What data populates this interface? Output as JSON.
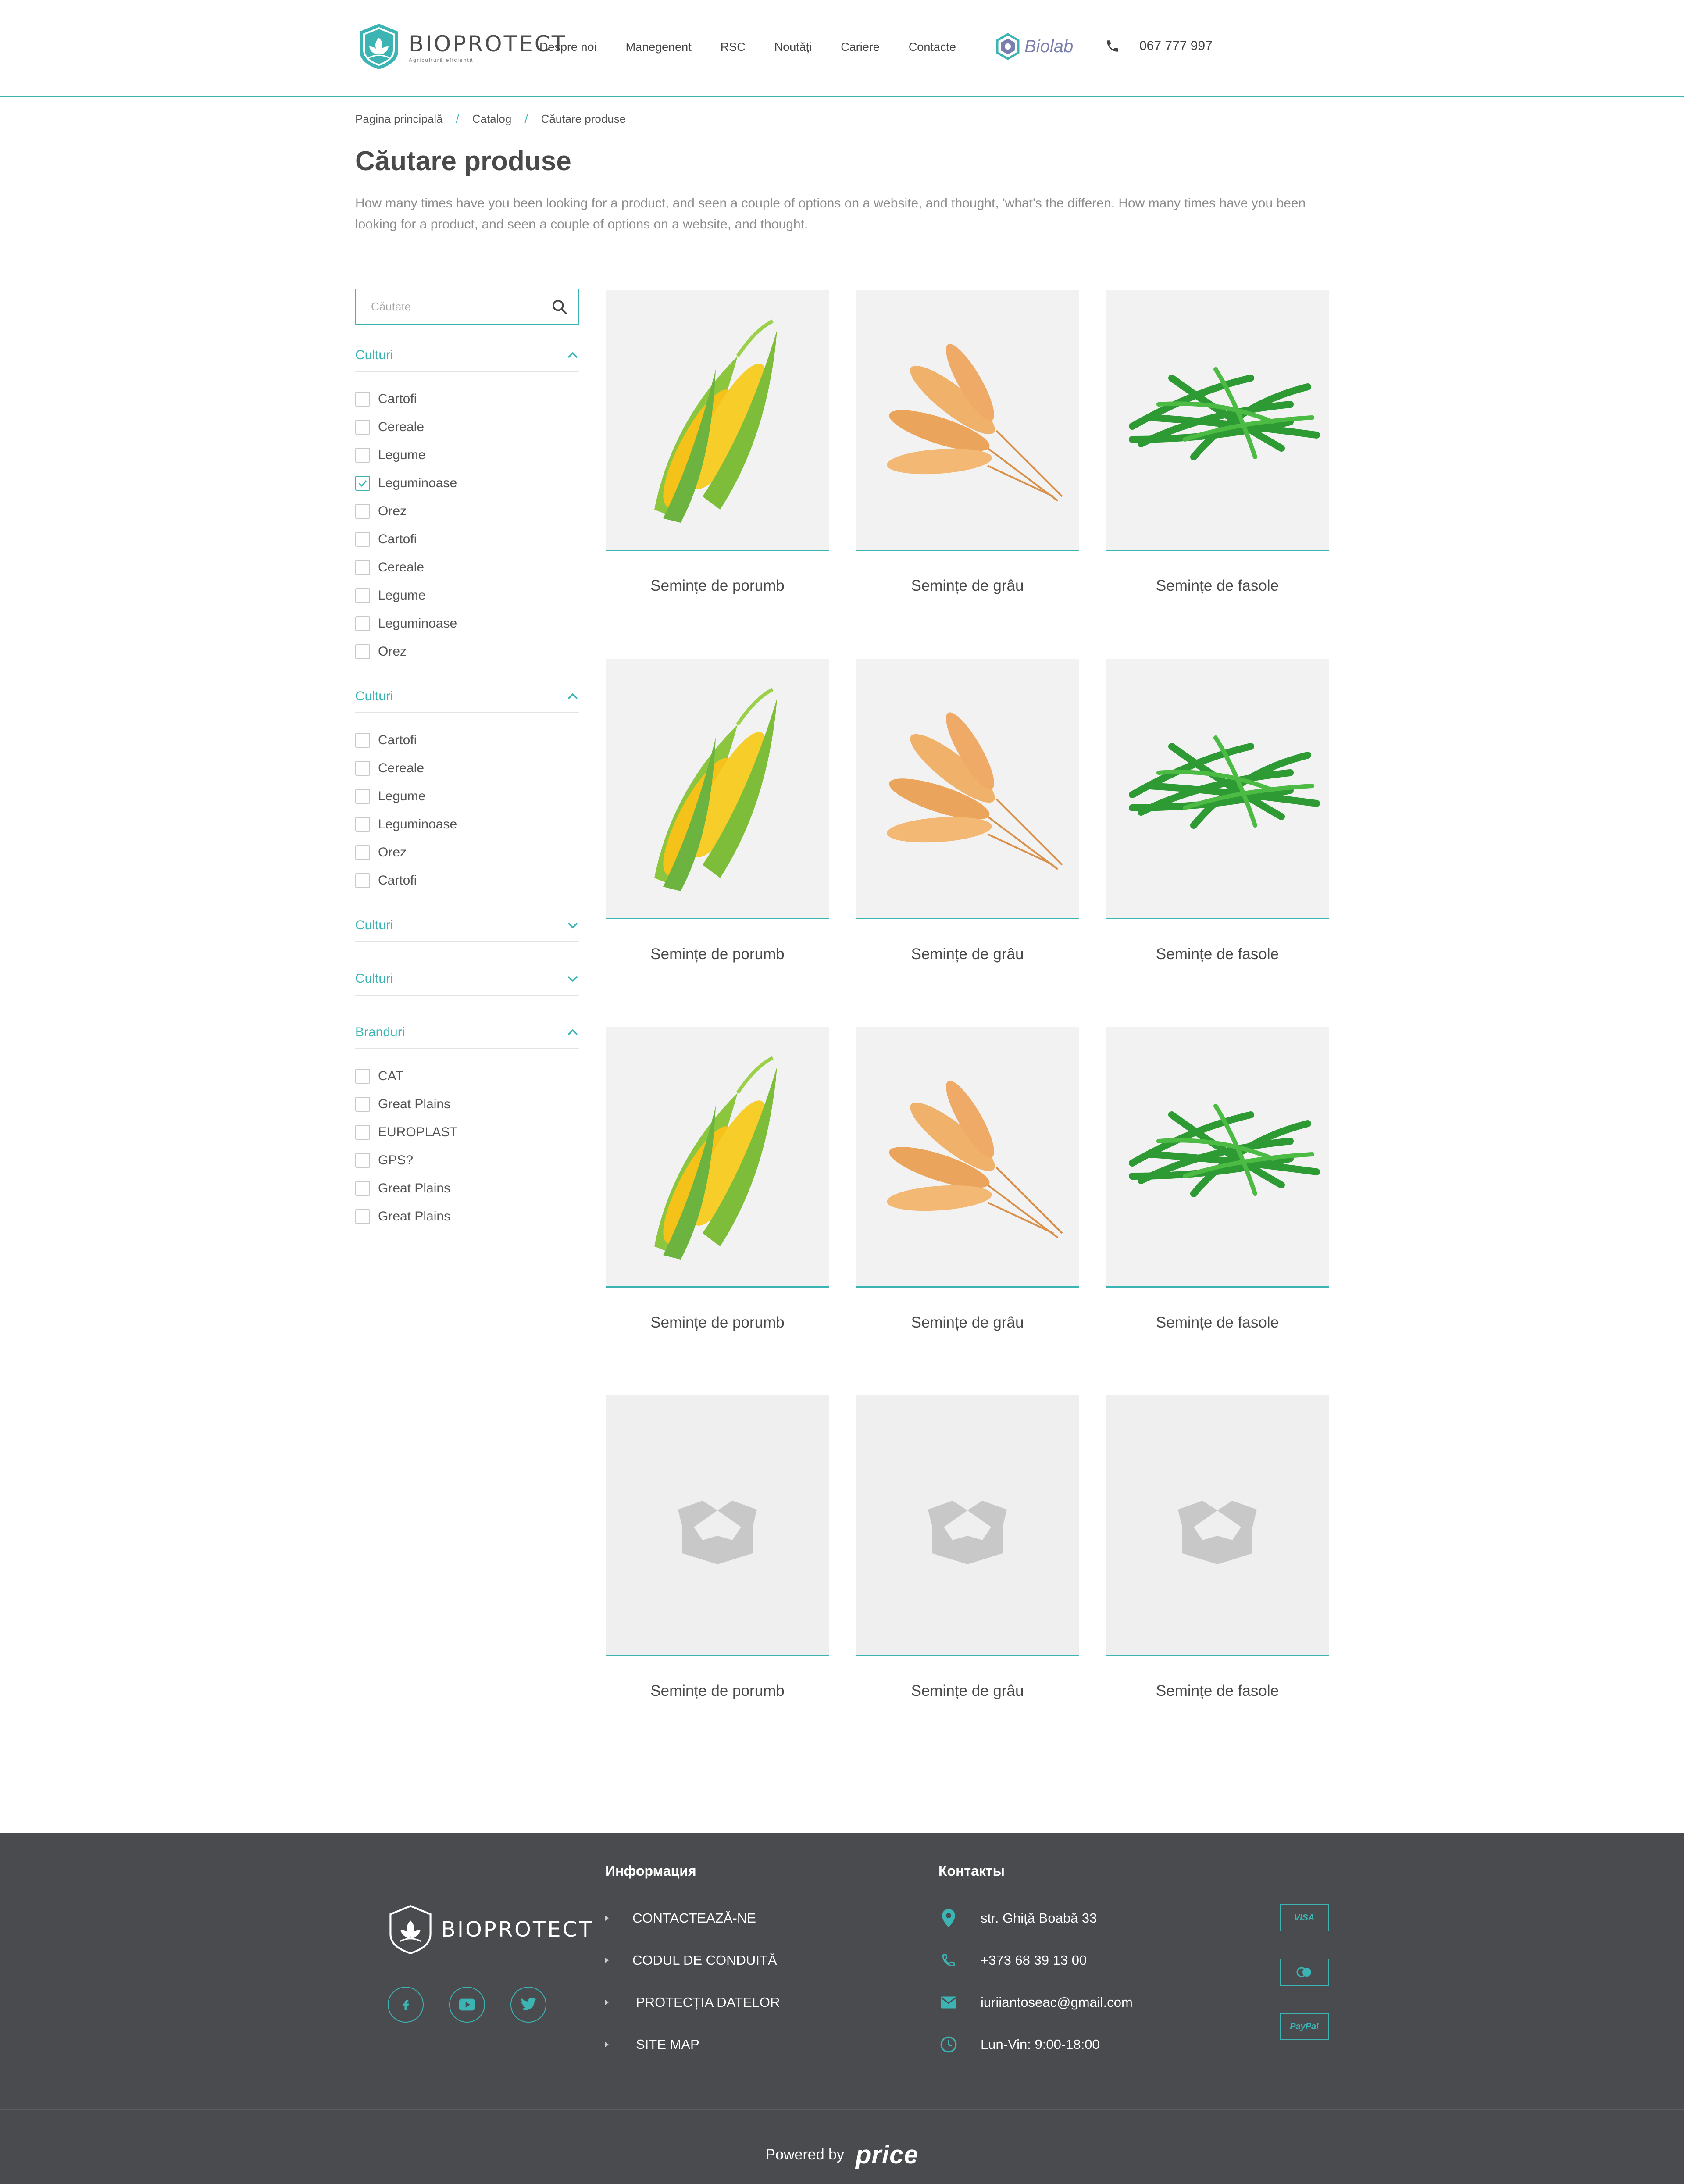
{
  "header": {
    "logo_text": "BIOPROTECT",
    "logo_tagline": "Agricultură eficientă",
    "nav": [
      "Despre noi",
      "Manegenent",
      "RSC",
      "Noutăți",
      "Cariere",
      "Contacte"
    ],
    "partner_logo": "Biolab",
    "phone": "067 777 997"
  },
  "breadcrumb": [
    "Pagina principală",
    "Catalog",
    "Căutare produse"
  ],
  "page": {
    "title": "Căutare produse",
    "description": "How many times have you been looking for a product, and seen a couple of options on a website, and thought, 'what's the differen. How many times have you been looking for a product, and seen a couple of options on a website, and thought."
  },
  "search": {
    "placeholder": "Căutate"
  },
  "filters": [
    {
      "title": "Culturi",
      "expanded": true,
      "items": [
        {
          "label": "Cartofi",
          "checked": false
        },
        {
          "label": "Cereale",
          "checked": false
        },
        {
          "label": "Legume",
          "checked": false
        },
        {
          "label": "Leguminoase",
          "checked": true
        },
        {
          "label": "Orez",
          "checked": false
        },
        {
          "label": "Cartofi",
          "checked": false
        },
        {
          "label": "Cereale",
          "checked": false
        },
        {
          "label": "Legume",
          "checked": false
        },
        {
          "label": "Leguminoase",
          "checked": false
        },
        {
          "label": "Orez",
          "checked": false
        }
      ]
    },
    {
      "title": "Culturi",
      "expanded": true,
      "items": [
        {
          "label": "Cartofi",
          "checked": false
        },
        {
          "label": "Cereale",
          "checked": false
        },
        {
          "label": "Legume",
          "checked": false
        },
        {
          "label": "Leguminoase",
          "checked": false
        },
        {
          "label": "Orez",
          "checked": false
        },
        {
          "label": "Cartofi",
          "checked": false
        }
      ]
    },
    {
      "title": "Culturi",
      "expanded": false,
      "items": []
    },
    {
      "title": "Culturi",
      "expanded": false,
      "items": []
    },
    {
      "title": "Branduri",
      "expanded": true,
      "items": [
        {
          "label": "CAT",
          "checked": false
        },
        {
          "label": "Great Plains",
          "checked": false
        },
        {
          "label": "EUROPLAST",
          "checked": false
        },
        {
          "label": "GPS?",
          "checked": false
        },
        {
          "label": "Great Plains",
          "checked": false
        },
        {
          "label": "Great Plains",
          "checked": false
        }
      ]
    }
  ],
  "products": [
    {
      "name": "Semințe de porumb",
      "image": "corn"
    },
    {
      "name": "Semințe de grâu",
      "image": "wheat"
    },
    {
      "name": "Semințe de fasole",
      "image": "beans"
    },
    {
      "name": "Semințe de porumb",
      "image": "corn"
    },
    {
      "name": "Semințe de grâu",
      "image": "wheat"
    },
    {
      "name": "Semințe de fasole",
      "image": "beans"
    },
    {
      "name": "Semințe de porumb",
      "image": "corn"
    },
    {
      "name": "Semințe de grâu",
      "image": "wheat"
    },
    {
      "name": "Semințe de fasole",
      "image": "beans"
    },
    {
      "name": "Semințe de porumb",
      "image": "placeholder-box"
    },
    {
      "name": "Semințe de grâu",
      "image": "placeholder-box"
    },
    {
      "name": "Semințe de fasole",
      "image": "placeholder-box"
    }
  ],
  "footer": {
    "logo_text": "BIOPROTECT",
    "socials": [
      "facebook-icon",
      "youtube-icon",
      "twitter-icon"
    ],
    "info_title": "Информация",
    "info_links": [
      "CONTACTEAZĂ-NE",
      "CODUL DE CONDUITĂ",
      "PROTECȚIA DATELOR",
      "SITE MAP"
    ],
    "contacts_title": "Контакты",
    "contacts": [
      {
        "icon": "location-pin-icon",
        "text": "str. Ghiță Boabă 33"
      },
      {
        "icon": "phone-icon",
        "text": "+373 68 39 13 00"
      },
      {
        "icon": "mail-icon",
        "text": "iuriiantoseac@gmail.com"
      },
      {
        "icon": "clock-icon",
        "text": "Lun-Vin: 9:00-18:00"
      }
    ],
    "payments": [
      "VISA",
      "",
      "PayPal"
    ],
    "powered_by": "Powered by",
    "powered_brand": "price"
  },
  "colors": {
    "accent": "#3cb4b4",
    "footer_bg": "#4a4b4e",
    "text": "#4a4a4a",
    "muted": "#8c8c8c"
  }
}
